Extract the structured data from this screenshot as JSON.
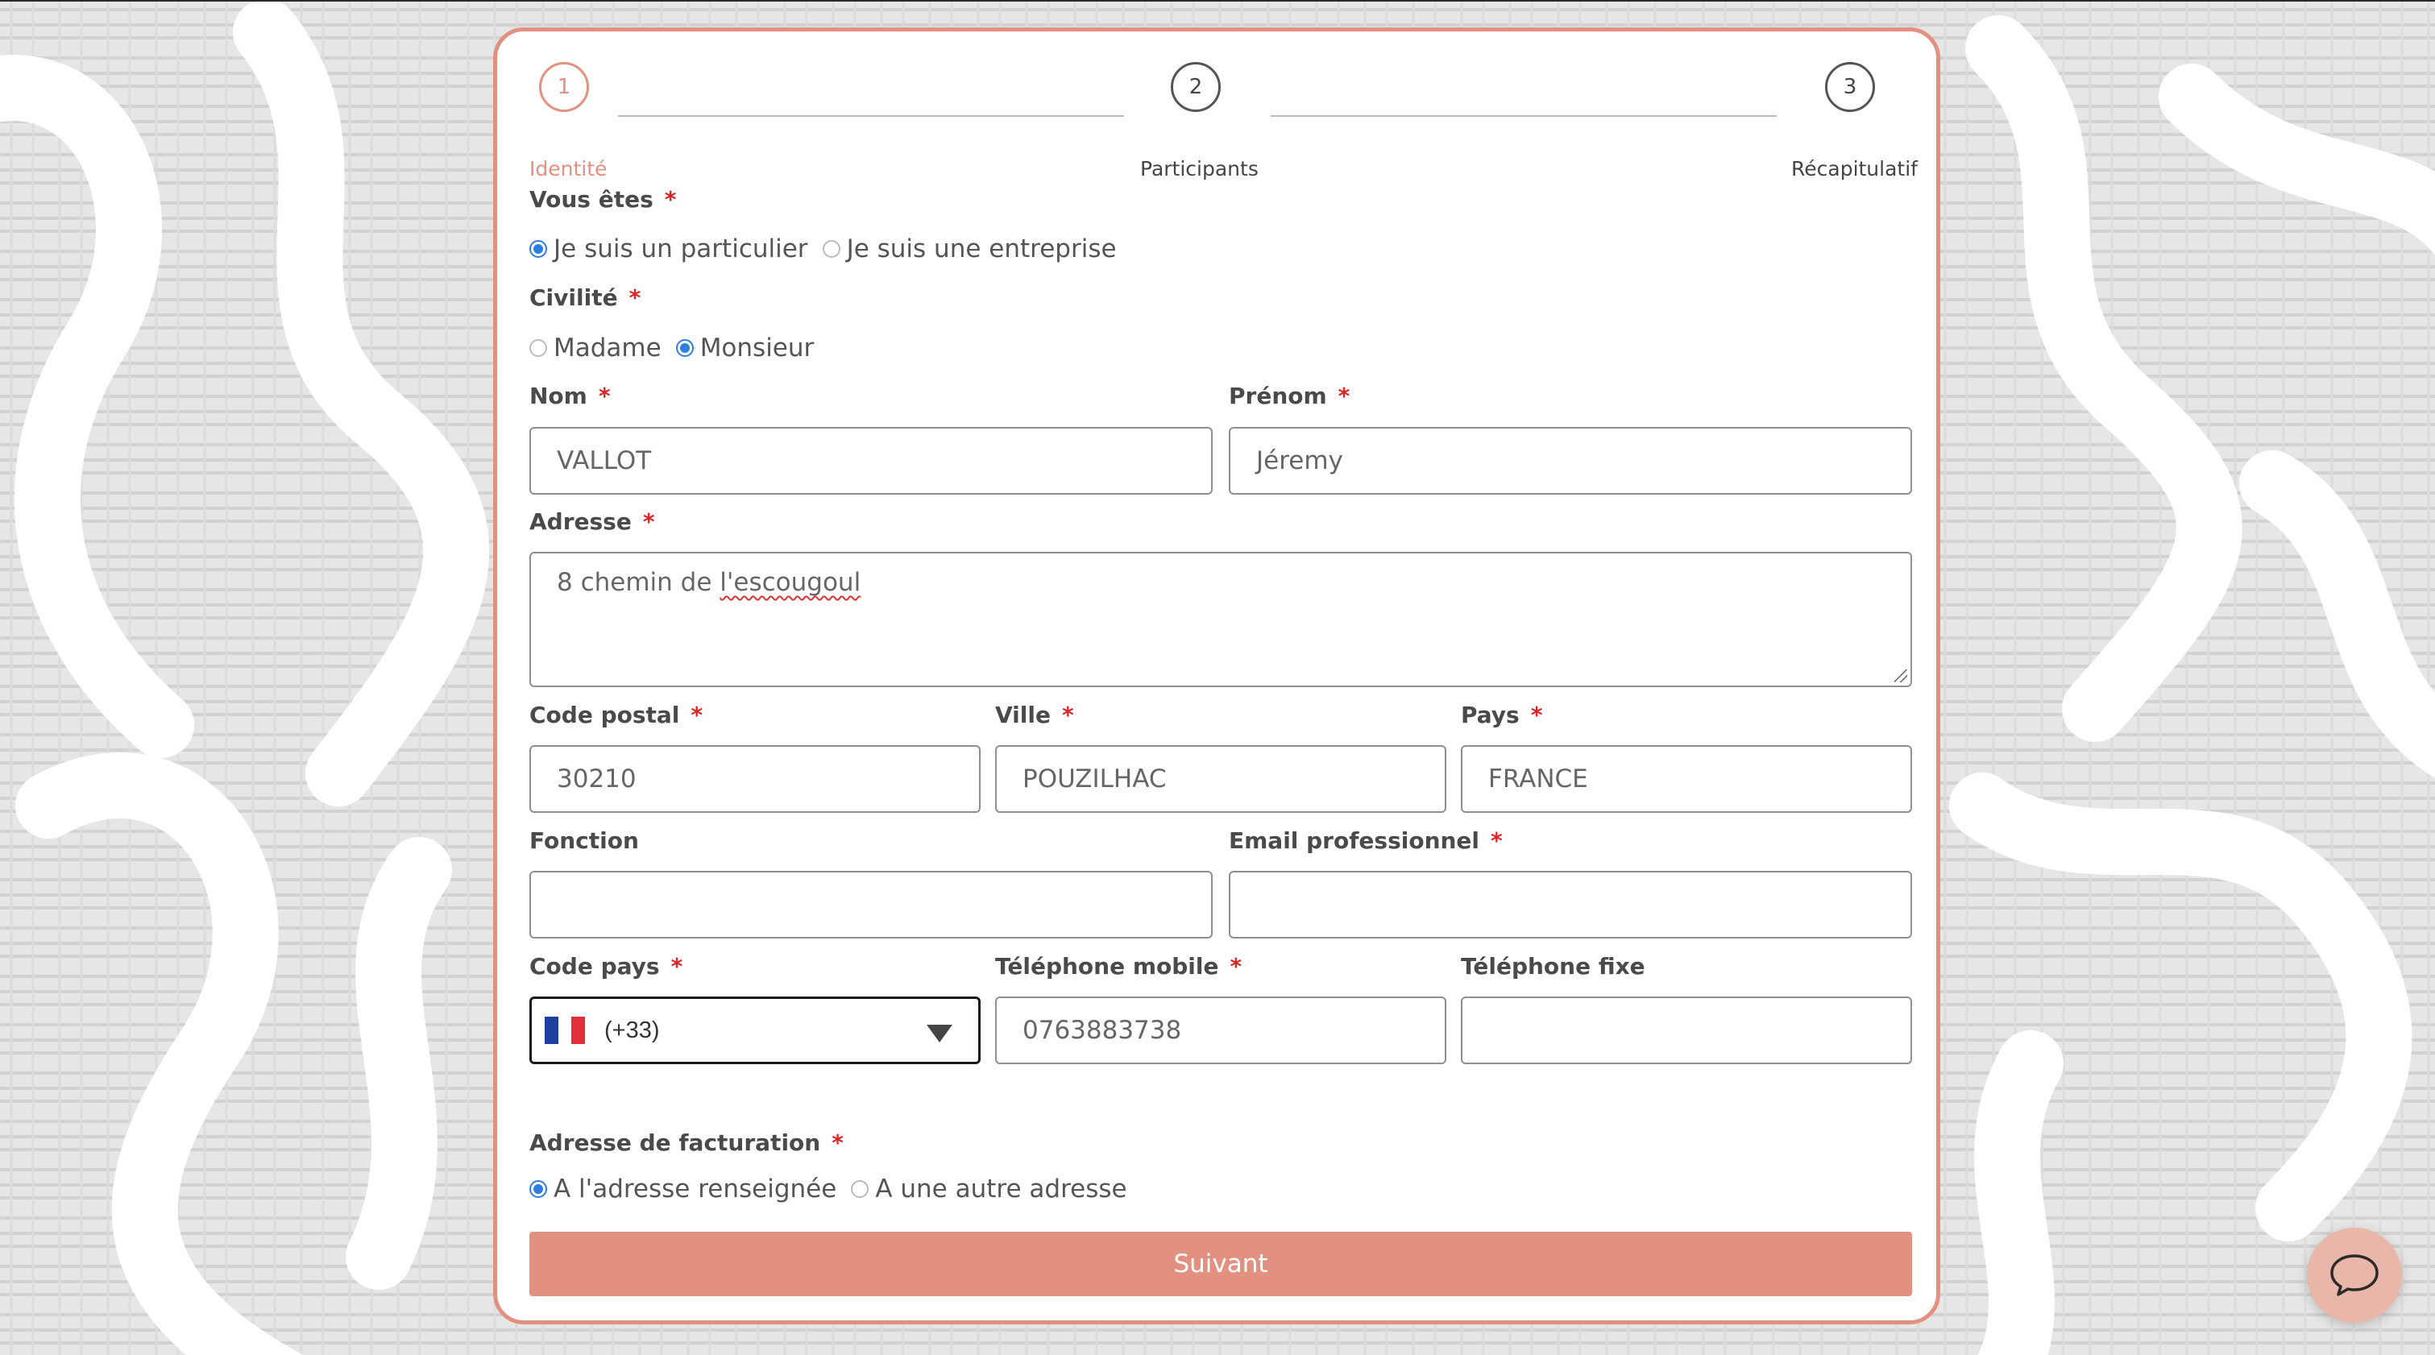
{
  "colors": {
    "accent": "#e2907f",
    "radio_checked": "#2f7de1",
    "required": "#e02424"
  },
  "stepper": {
    "steps": [
      {
        "number": "1",
        "label": "Identité",
        "active": true
      },
      {
        "number": "2",
        "label": "Participants",
        "active": false
      },
      {
        "number": "3",
        "label": "Récapitulatif",
        "active": false
      }
    ]
  },
  "form": {
    "vous_etes": {
      "label": "Vous êtes",
      "required_mark": "*",
      "options": [
        "Je suis un particulier",
        "Je suis une entreprise"
      ],
      "selected": "Je suis un particulier"
    },
    "civilite": {
      "label": "Civilité",
      "required_mark": "*",
      "options": [
        "Madame",
        "Monsieur"
      ],
      "selected": "Monsieur"
    },
    "nom": {
      "label": "Nom",
      "required_mark": "*",
      "value": "VALLOT"
    },
    "prenom": {
      "label": "Prénom",
      "required_mark": "*",
      "value": "Jéremy"
    },
    "adresse": {
      "label": "Adresse",
      "required_mark": "*",
      "value_plain": "8 chemin de ",
      "value_flagged": "l'escougoul"
    },
    "code_postal": {
      "label": "Code postal",
      "required_mark": "*",
      "value": "30210"
    },
    "ville": {
      "label": "Ville",
      "required_mark": "*",
      "value": "POUZILHAC"
    },
    "pays": {
      "label": "Pays",
      "required_mark": "*",
      "value": "FRANCE"
    },
    "fonction": {
      "label": "Fonction",
      "value": ""
    },
    "email_pro": {
      "label": "Email professionnel",
      "required_mark": "*",
      "value": ""
    },
    "code_pays": {
      "label": "Code pays",
      "required_mark": "*",
      "value": "(+33)",
      "flag_icon": "france-flag-icon"
    },
    "tel_mobile": {
      "label": "Téléphone mobile",
      "required_mark": "*",
      "value": "0763883738"
    },
    "tel_fixe": {
      "label": "Téléphone fixe",
      "value": ""
    },
    "facturation": {
      "label": "Adresse de facturation",
      "required_mark": "*",
      "options": [
        "A l'adresse renseignée",
        "A une autre adresse"
      ],
      "selected": "A l'adresse renseignée"
    },
    "submit_label": "Suivant"
  },
  "chat_widget": {
    "icon": "chat-bubble-icon"
  }
}
